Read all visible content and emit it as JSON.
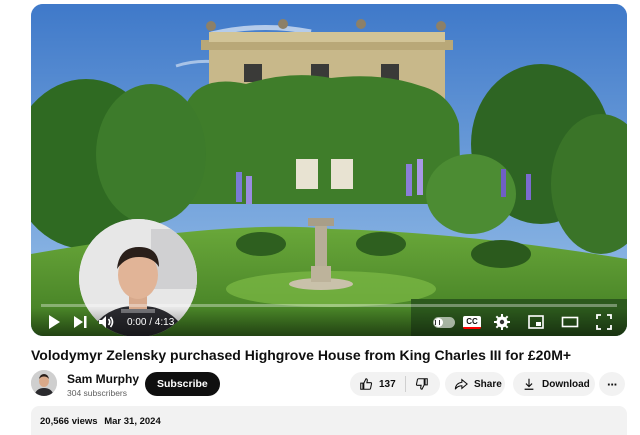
{
  "video": {
    "title": "Volodymyr Zelensky purchased Highgrove House from King Charles III for £20M+",
    "time_display": "0:00 / 4:13",
    "progress_fraction": 0.0,
    "cc_label": "CC"
  },
  "channel": {
    "name": "Sam Murphy",
    "subscribers": "304 subscribers",
    "subscribe_label": "Subscribe"
  },
  "actions": {
    "like_count": "137",
    "share_label": "Share",
    "download_label": "Download"
  },
  "description": {
    "views": "20,566 views",
    "date": "Mar 31, 2024"
  },
  "icons": {
    "player": [
      "play-icon",
      "next-icon",
      "volume-icon",
      "autoplay-toggle-icon",
      "cc-icon",
      "settings-icon",
      "miniplayer-icon",
      "theater-icon",
      "fullscreen-icon"
    ],
    "actions": [
      "thumbs-up-icon",
      "thumbs-down-icon",
      "share-icon",
      "download-icon",
      "more-icon"
    ]
  },
  "colors": {
    "progress": "#ff0000",
    "subscribe_bg": "#0f0f0f",
    "pill_bg": "#f2f2f2",
    "sky": "#5a8fd0",
    "lawn": "#4f8a2a"
  }
}
